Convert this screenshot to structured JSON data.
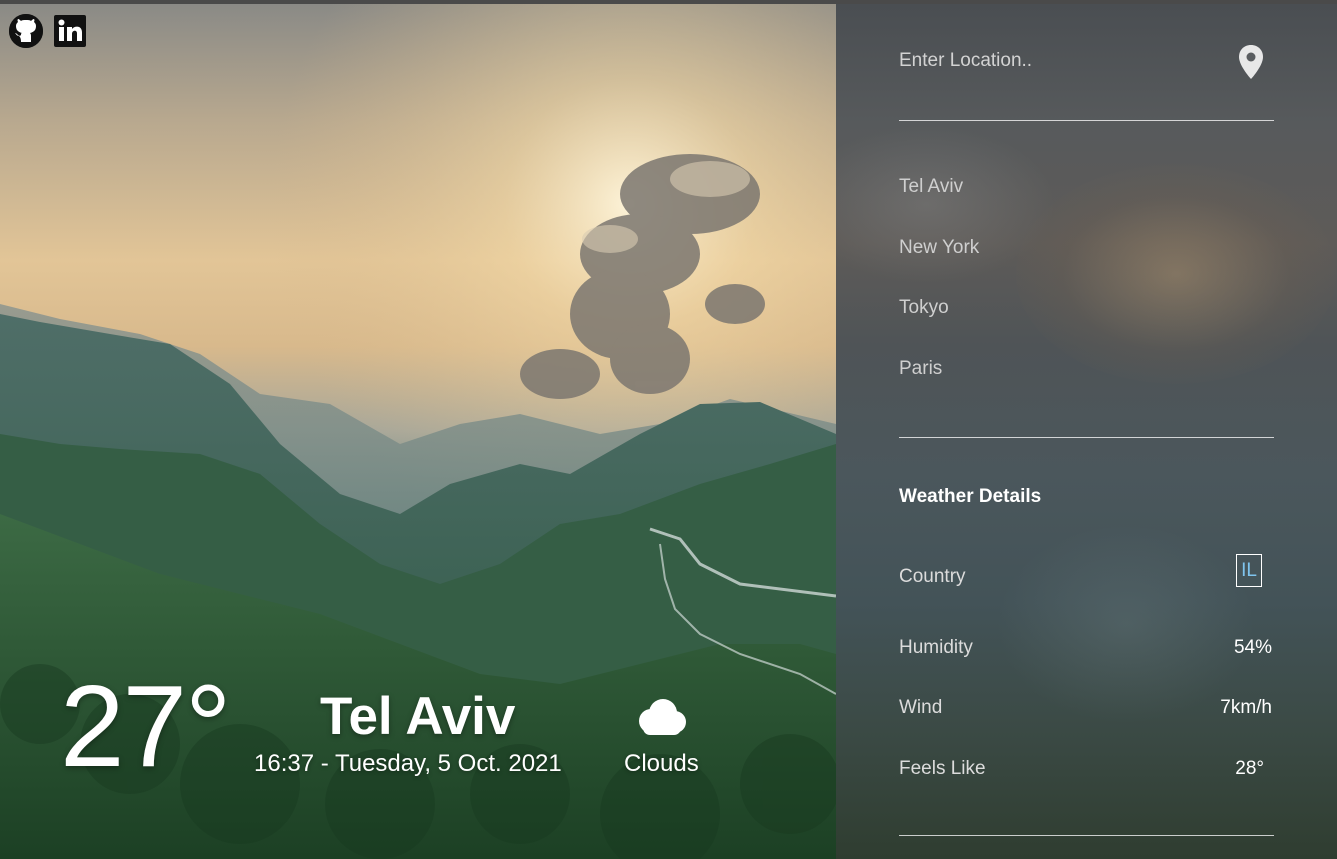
{
  "social": {
    "github_icon": "github-icon",
    "linkedin_icon": "linkedin-icon"
  },
  "search": {
    "placeholder": "Enter Location..",
    "icon": "location-pin-icon"
  },
  "cities": [
    "Tel Aviv",
    "New York",
    "Tokyo",
    "Paris"
  ],
  "details": {
    "title": "Weather Details",
    "country_label": "Country",
    "country_value": "IL",
    "humidity_label": "Humidity",
    "humidity_value": "54%",
    "wind_label": "Wind",
    "wind_value": "7km/h",
    "feels_label": "Feels Like",
    "feels_value": "28°"
  },
  "current": {
    "temperature": "27°",
    "city": "Tel Aviv",
    "datetime": "16:37 - Tuesday, 5 Oct. 2021",
    "condition": "Clouds",
    "condition_icon": "cloud-icon"
  },
  "colors": {
    "country_badge_text": "#7fc4ee",
    "text": "#ffffff"
  }
}
